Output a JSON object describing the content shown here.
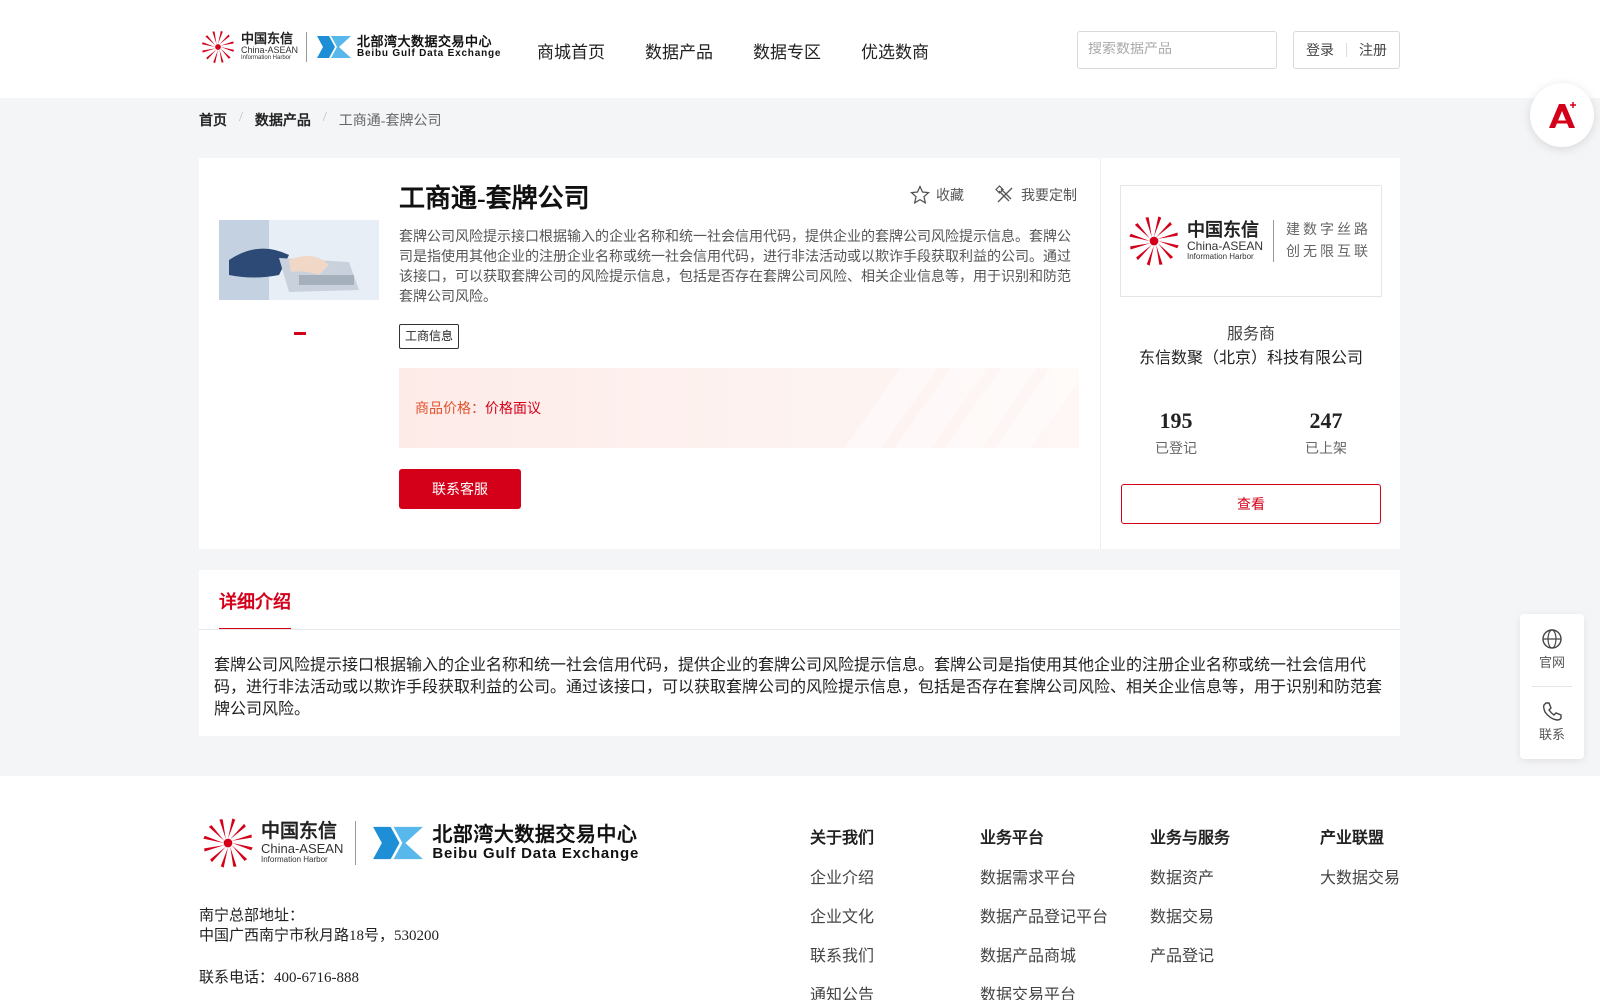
{
  "header": {
    "brand": {
      "cn": "中国东信",
      "en": "China-ASEAN",
      "en2": "Information Harbor"
    },
    "exchange": {
      "cn": "北部湾大数据交易中心",
      "en": "Beibu Gulf Data Exchange"
    },
    "nav": [
      "商城首页",
      "数据产品",
      "数据专区",
      "优选数商"
    ],
    "search_placeholder": "搜索数据产品",
    "login": "登录",
    "register": "注册"
  },
  "breadcrumb": [
    "首页",
    "数据产品",
    "工商通-套牌公司"
  ],
  "product": {
    "title": "工商通-套牌公司",
    "favorite": "收藏",
    "customize": "我要定制",
    "description": "套牌公司风险提示接口根据输入的企业名称和统一社会信用代码，提供企业的套牌公司风险提示信息。套牌公司是指使用其他企业的注册企业名称或统一社会信用代码，进行非法活动或以欺诈手段获取利益的公司。通过该接口，可以获取套牌公司的风险提示信息，包括是否存在套牌公司风险、相关企业信息等，用于识别和防范套牌公司风险。",
    "tag": "工商信息",
    "price_label": "商品价格：",
    "price_value": "价格面议",
    "contact_button": "联系客服"
  },
  "provider": {
    "slogan_line1": "建数字丝路",
    "slogan_line2": "创无限互联",
    "label": "服务商",
    "name": "东信数聚（北京）科技有限公司",
    "stats": [
      {
        "value": "195",
        "label": "已登记"
      },
      {
        "value": "247",
        "label": "已上架"
      }
    ],
    "view_button": "查看"
  },
  "detail": {
    "tab": "详细介绍",
    "text": "套牌公司风险提示接口根据输入的企业名称和统一社会信用代码，提供企业的套牌公司风险提示信息。套牌公司是指使用其他企业的注册企业名称或统一社会信用代码，进行非法活动或以欺诈手段获取利益的公司。通过该接口，可以获取套牌公司的风险提示信息，包括是否存在套牌公司风险、相关企业信息等，用于识别和防范套牌公司风险。"
  },
  "side": {
    "website": "官网",
    "contact": "联系"
  },
  "footer": {
    "address_label": "南宁总部地址：",
    "address": "中国广西南宁市秋月路18号，530200",
    "phone": "联系电话：400-6716-888",
    "columns": [
      {
        "title": "关于我们",
        "items": [
          "企业介绍",
          "企业文化",
          "联系我们",
          "通知公告"
        ]
      },
      {
        "title": "业务平台",
        "items": [
          "数据需求平台",
          "数据产品登记平台",
          "数据产品商城",
          "数据交易平台"
        ]
      },
      {
        "title": "业务与服务",
        "items": [
          "数据资产",
          "数据交易",
          "产品登记"
        ]
      },
      {
        "title": "产业联盟",
        "items": [
          "大数据交易"
        ]
      }
    ]
  },
  "colors": {
    "accent": "#d4001a",
    "price": "#e0532f",
    "exchange_blue": "#1e8fd6"
  },
  "icons": [
    "search-icon",
    "star-icon",
    "customize-icon",
    "globe-icon",
    "phone-icon",
    "assistant-icon"
  ]
}
